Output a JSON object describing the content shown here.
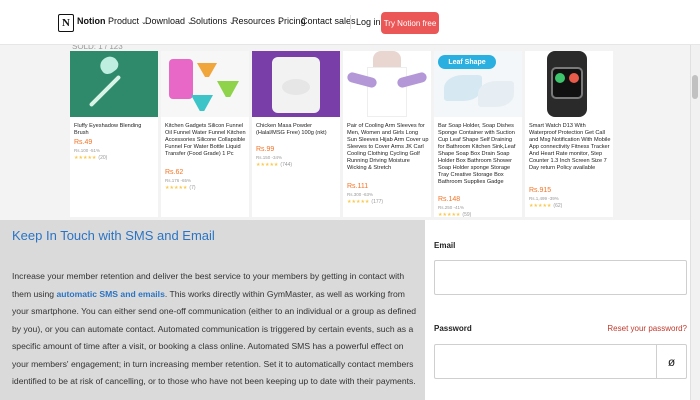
{
  "nav": {
    "brand": "Notion",
    "logo_letter": "N",
    "items": [
      {
        "label": "Product",
        "chevron": "⌄"
      },
      {
        "label": "Download",
        "chevron": "⌄"
      },
      {
        "label": "Solutions",
        "chevron": "⌄"
      },
      {
        "label": "Resources",
        "chevron": "⌄"
      },
      {
        "label": "Pricing",
        "chevron": ""
      },
      {
        "label": "Contact sales",
        "chevron": ""
      }
    ],
    "login": "Log in",
    "cta": "Try Notion free",
    "cta_color": "#eb5757"
  },
  "strip": {
    "top_text": "SOLD: 1 / 123",
    "products": [
      {
        "name": "Fluffy Eyeshadow Blending Brush",
        "price": "Rs.49",
        "old": "Rs.100 -51%",
        "rating": "★★★★★",
        "reviews": "(20)"
      },
      {
        "name": "Kitchen Gadgets Silicon Funnel Oil Funnel Water Funnel Kitchen Accessories Silicone Collapsible Funnel For Water Bottle Liquid Transfer (Food Grade) 1 Pc",
        "price": "Rs.62",
        "old": "Rs.176 -65%",
        "rating": "★★★★★",
        "reviews": "(7)"
      },
      {
        "name": "Chicken Masa Powder (Halal/MSG Free) 100g (nkt)",
        "price": "Rs.99",
        "old": "Rs.150 -34%",
        "rating": "★★★★★",
        "reviews": "(744)"
      },
      {
        "name": "Pair of Cooling Arm Sleeves for Men, Women and Girls Long Sun Sleeves Hijab Arm Cover up Sleeves to Cover Arms JK Carl Cooling Clothing Cycling Golf Running Driving Moisture Wicking & Stretch",
        "price": "Rs.111",
        "old": "Rs.300 -63%",
        "rating": "★★★★★",
        "reviews": "(177)"
      },
      {
        "name": "Bar Soap Holder, Soap Dishes Sponge Container with Suction Cup Leaf Shape Self Draining for Bathroom Kitchen Sink,Leaf Shape Soap Box Drain Soap Holder Box Bathroom Shower Soap Holder sponge Storage Tray Creative Storage Box Bathroom Supplies Gadge",
        "price": "Rs.148",
        "old": "Rs.250 -41%",
        "rating": "★★★★★",
        "reviews": "(59)"
      },
      {
        "name": "Smart Watch D13 With Waterproof Protection Get Call and Msg Notification With Mobile App connectivity Fitness Tracker And Heart Rate monitor, Step Counter 1.3 Inch Screen Size 7 Day return Policy available",
        "price": "Rs.915",
        "old": "Rs.1,499 -39%",
        "rating": "★★★★★",
        "reviews": "(62)"
      }
    ]
  },
  "content": {
    "title": "Keep In Touch with SMS and Email",
    "p1": "Increase your member retention and deliver the best service to your members by getting in contact with them using ",
    "link": "automatic SMS and emails",
    "p2": ". This works directly within GymMaster, as well as working from your smartphone. You can either send one-off communication (either to an individual or a group as defined by you), or you can automate contact. Automated communication is triggered by certain events, such as a specific amount of time after a visit, or booking a class online. Automated SMS has a powerful effect on your members' engagement; in turn increasing member retention. Set it to automatically contact members identified to be at risk of cancelling, or to those who have not been keeping up to date with their payments."
  },
  "form": {
    "email_label": "Email",
    "email_value": "",
    "password_label": "Password",
    "password_value": "",
    "forgot": "Reset your password?",
    "eye_icon": "ø"
  }
}
